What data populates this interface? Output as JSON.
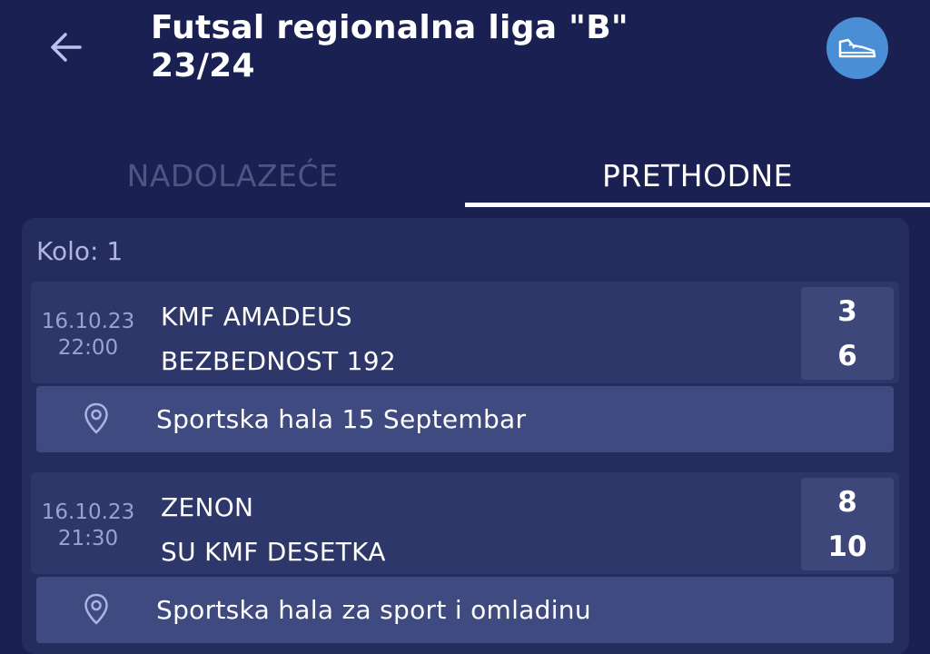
{
  "header": {
    "title_line1": "Futsal regionalna liga \"B\"",
    "title_line2": "23/24",
    "back_icon": "arrow-left-icon",
    "action_icon": "sneaker-icon"
  },
  "tabs": [
    {
      "label": "NADOLAZEĆE",
      "active": false
    },
    {
      "label": "PRETHODNE",
      "active": true
    }
  ],
  "round": {
    "label": "Kolo: 1"
  },
  "matches": [
    {
      "date": "16.10.23",
      "time": "22:00",
      "home": "KMF AMADEUS",
      "away": "BEZBEDNOST 192",
      "home_score": "3",
      "away_score": "6",
      "venue": "Sportska hala 15 Septembar"
    },
    {
      "date": "16.10.23",
      "time": "21:30",
      "home": "ZENON",
      "away": "SU KMF DESETKA",
      "home_score": "8",
      "away_score": "10",
      "venue": "Sportska hala za sport i omladinu"
    }
  ],
  "colors": {
    "background": "#1a2152",
    "panel": "#252d5f",
    "accent_button": "#4a8fd6",
    "inactive_tab": "#4d5682"
  }
}
